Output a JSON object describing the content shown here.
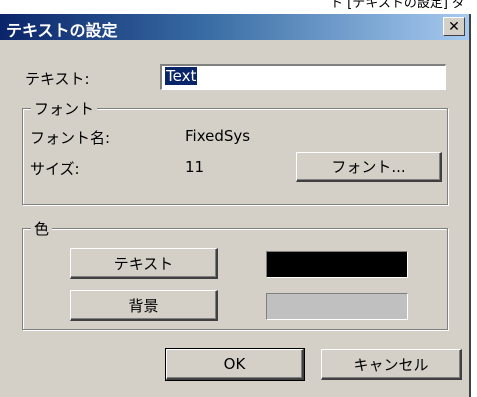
{
  "background_caption": "ト [テキストの設定] ダイアロ",
  "dialog": {
    "title": "テキストの設定",
    "close_glyph": "✕",
    "text_label": "テキスト:",
    "text_value": "Text",
    "font_group": {
      "title": "フォント",
      "name_label": "フォント名:",
      "name_value": "FixedSys",
      "size_label": "サイズ:",
      "size_value": "11",
      "font_button": "フォント..."
    },
    "color_group": {
      "title": "色",
      "text_button": "テキスト",
      "background_button": "背景",
      "text_color": "#000000",
      "background_color": "#c0c0c0"
    },
    "ok_button": "OK",
    "cancel_button": "キャンセル"
  },
  "colors": {
    "titlebar_start": "#0a246a",
    "titlebar_end": "#a6caf0",
    "dialog_face": "#d4d0c8"
  }
}
